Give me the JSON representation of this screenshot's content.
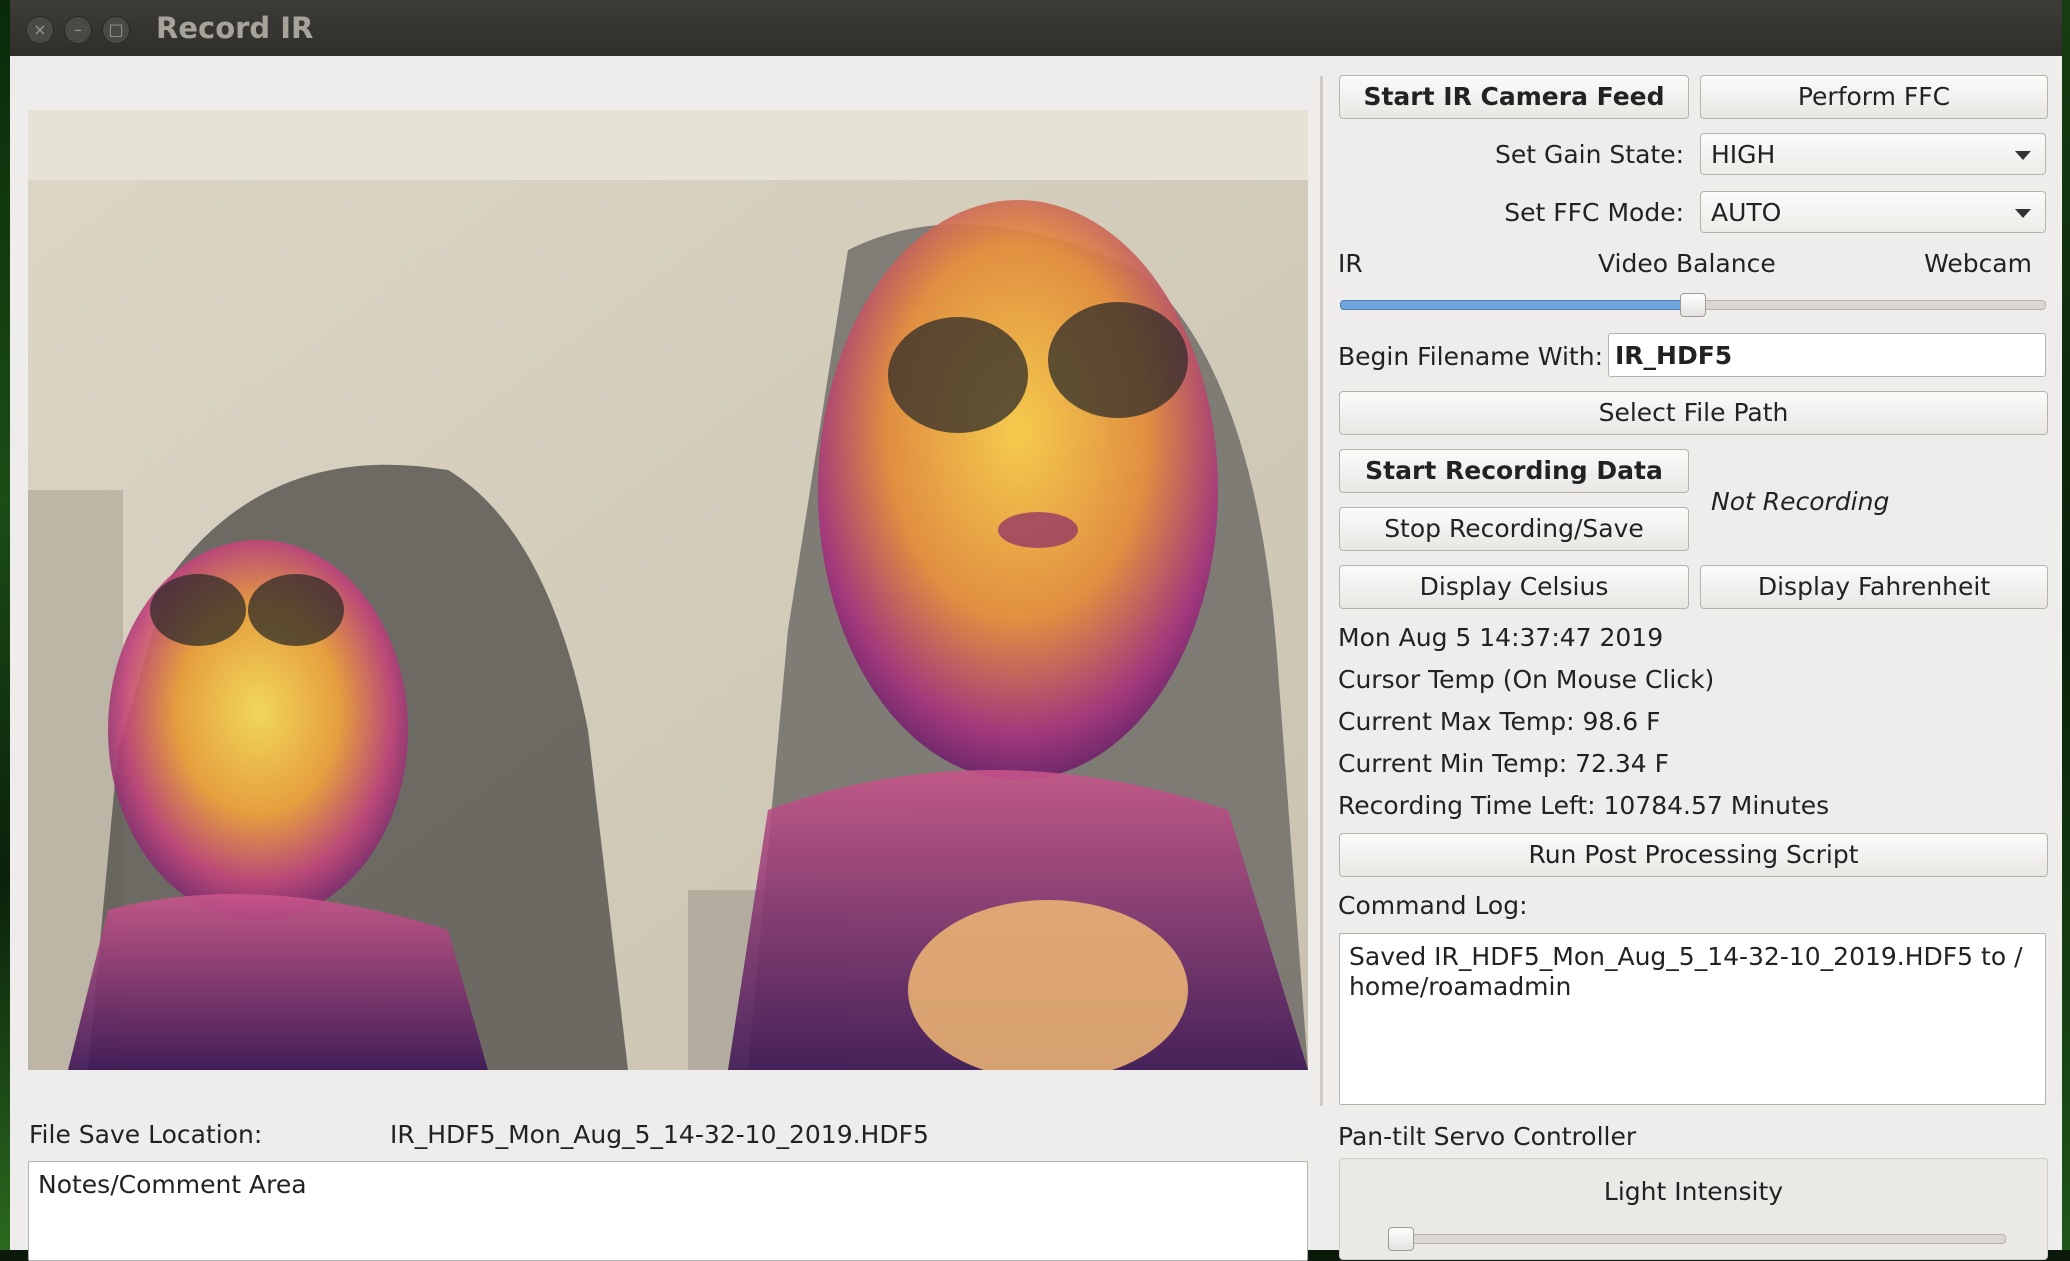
{
  "window": {
    "title": "Record IR"
  },
  "controls": {
    "start_feed": "Start IR Camera Feed",
    "perform_ffc": "Perform FFC",
    "gain_label": "Set Gain State:",
    "gain_value": "HIGH",
    "ffc_label": "Set FFC Mode:",
    "ffc_value": "AUTO",
    "balance_left": "IR",
    "balance_title": "Video Balance",
    "balance_right": "Webcam",
    "balance_value": 0.5,
    "filename_label": "Begin Filename With:",
    "filename_value": "IR_HDF5",
    "select_path": "Select File Path",
    "start_recording": "Start Recording Data",
    "stop_recording": "Stop Recording/Save",
    "recording_status": "Not Recording",
    "display_celsius": "Display Celsius",
    "display_fahrenheit": "Display Fahrenheit"
  },
  "status": {
    "datetime": "Mon Aug 5 14:37:47 2019",
    "cursor_temp": "Cursor Temp (On Mouse Click)",
    "max_temp": "Current Max Temp: 98.6 F",
    "min_temp": "Current Min Temp: 72.34 F",
    "time_left": "Recording Time Left: 10784.57 Minutes"
  },
  "post_processing": "Run Post Processing Script",
  "log": {
    "label": "Command Log:",
    "text": "Saved IR_HDF5_Mon_Aug_5_14-32-10_2019.HDF5 to /\nhome/roamadmin"
  },
  "servo": {
    "label": "Pan-tilt Servo Controller",
    "light_label": "Light Intensity",
    "light_value": 0.0
  },
  "file": {
    "label": "File Save Location:",
    "value": "IR_HDF5_Mon_Aug_5_14-32-10_2019.HDF5"
  },
  "notes": {
    "text": "Notes/Comment Area"
  },
  "colors": {
    "accent": "#6fa4dc",
    "titlebar": "#2f2e2b",
    "window_bg": "#efedeb"
  }
}
